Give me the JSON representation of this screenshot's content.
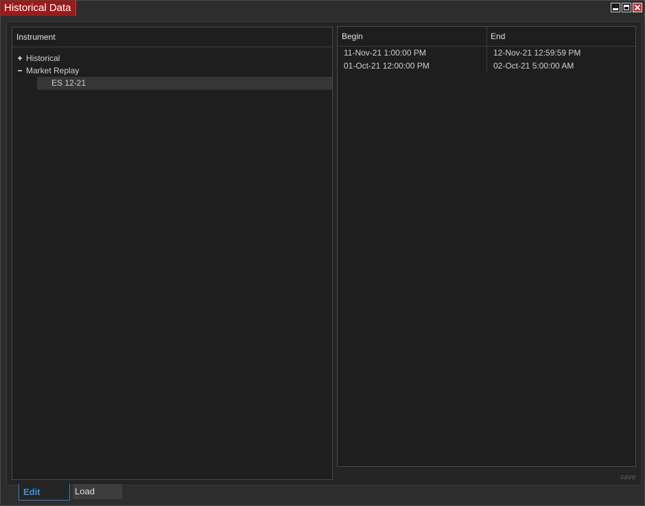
{
  "window": {
    "title": "Historical Data",
    "controls": [
      "minimize-icon",
      "maximize-icon",
      "close-icon"
    ]
  },
  "instrument_panel": {
    "header": "Instrument",
    "tree": [
      {
        "label": "Historical",
        "expander": "+",
        "expanded": false
      },
      {
        "label": "Market Replay",
        "expander": "−",
        "expanded": true
      }
    ],
    "selected_child": "ES 12-21"
  },
  "range_panel": {
    "columns": [
      "Begin",
      "End"
    ],
    "rows": [
      {
        "begin": "11-Nov-21 1:00:00 PM",
        "end": "12-Nov-21 12:59:59 PM"
      },
      {
        "begin": "01-Oct-21 12:00:00 PM",
        "end": "02-Oct-21 5:00:00 AM"
      }
    ]
  },
  "footer": {
    "save_label": "save"
  },
  "tabs": [
    {
      "label": "Edit",
      "active": true
    },
    {
      "label": "Load",
      "active": false
    }
  ],
  "colors": {
    "title_accent": "#9b1b1b",
    "active_tab": "#3a8fe0",
    "close_button": "#c62a2a"
  }
}
